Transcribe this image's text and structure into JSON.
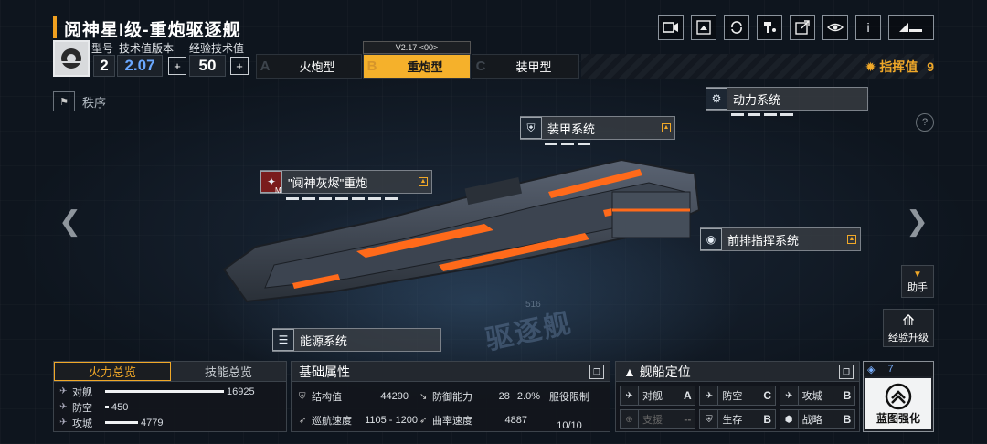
{
  "header": {
    "title": "阅神星I级-重炮驱逐舰",
    "icons": [
      "video-icon",
      "share-image-icon",
      "refresh-icon",
      "paint-icon",
      "external-link-icon",
      "view-icon",
      "info-icon",
      "back-icon"
    ],
    "info_glyph": "i"
  },
  "info": {
    "model_label": "型号",
    "model_value": "2",
    "tech_version_label": "技术值版本",
    "tech_version_value": "2.07",
    "exp_tech_label": "经验技术值",
    "exp_tech_value": "50",
    "plus": "+"
  },
  "tabs": {
    "version": "V2.17 <00>",
    "items": [
      {
        "letter": "A",
        "label": "火炮型"
      },
      {
        "letter": "B",
        "label": "重炮型"
      },
      {
        "letter": "C",
        "label": "装甲型"
      }
    ],
    "active_index": 1
  },
  "command": {
    "label": "指挥值",
    "value": "9"
  },
  "order": {
    "label": "秩序"
  },
  "callouts": {
    "power": "动力系统",
    "armor": "装甲系统",
    "cannon": "\"阋神灰烬\"重炮",
    "front_cmd": "前排指挥系统",
    "energy": "能源系统",
    "cannon_badge": "M"
  },
  "watermark": {
    "text": "驱逐舰",
    "number": "516"
  },
  "side": {
    "assistant": "助手",
    "exp_upgrade": "经验升级",
    "help": "?"
  },
  "fire_panel": {
    "tab_fire": "火力总览",
    "tab_skill": "技能总览",
    "rows": [
      {
        "label": "对舰",
        "value": "16925",
        "fraction": 1.0
      },
      {
        "label": "防空",
        "value": "450",
        "fraction": 0.03
      },
      {
        "label": "攻城",
        "value": "4779",
        "fraction": 0.28
      }
    ]
  },
  "base_attr": {
    "title": "基础属性",
    "structure_label": "结构值",
    "structure_value": "44290",
    "defense_label": "防御能力",
    "defense_value": "28",
    "defense_pct": "2.0%",
    "service_label": "服役限制",
    "service_value": "10/10",
    "cruise_label": "巡航速度",
    "cruise_value": "1105 - 1200",
    "curve_label": "曲率速度",
    "curve_value": "4887"
  },
  "positioning": {
    "title": "舰船定位",
    "cells": [
      {
        "label": "对舰",
        "grade": "A",
        "dim": false
      },
      {
        "label": "防空",
        "grade": "C",
        "dim": false
      },
      {
        "label": "攻城",
        "grade": "B",
        "dim": false
      },
      {
        "label": "支援",
        "grade": "--",
        "dim": true
      },
      {
        "label": "生存",
        "grade": "B",
        "dim": false
      },
      {
        "label": "战略",
        "grade": "B",
        "dim": false
      }
    ]
  },
  "blueprint": {
    "count": "7",
    "label": "蓝图强化"
  },
  "colors": {
    "accent": "#f0a828",
    "tab_active": "#f5b12b",
    "ship_glow": "#ff6a1a"
  }
}
